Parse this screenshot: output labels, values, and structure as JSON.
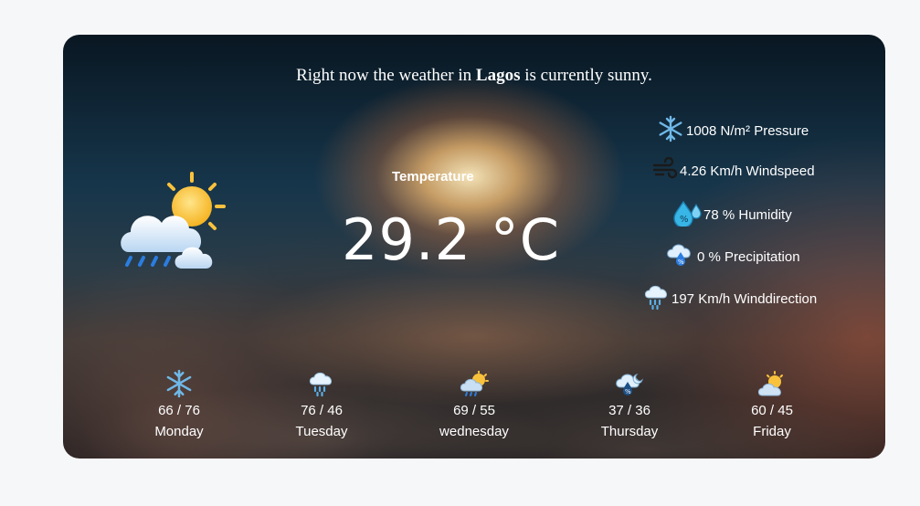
{
  "headline": {
    "prefix": "Right now the weather in ",
    "city": "Lagos",
    "suffix": " is currently sunny."
  },
  "current": {
    "icon": "sun-behind-rain-cloud-icon",
    "temperature_label": "Temperature",
    "temperature_value": "29.2 °C"
  },
  "stats": [
    {
      "icon": "snowflake-icon",
      "text": "1008 N/m² Pressure"
    },
    {
      "icon": "wind-icon",
      "text": "4.26 Km/h Windspeed"
    },
    {
      "icon": "humidity-drops-icon",
      "text": "78 % Humidity"
    },
    {
      "icon": "precipitation-cloud-icon",
      "text": "0 % Precipitation"
    },
    {
      "icon": "rain-cloud-icon",
      "text": "197 Km/h Winddirection"
    }
  ],
  "forecast": [
    {
      "icon": "snowflake-icon",
      "range": "66 / 76",
      "day": "Monday"
    },
    {
      "icon": "rain-cloud-icon",
      "range": "76 / 46",
      "day": "Tuesday"
    },
    {
      "icon": "sun-rain-cloud-icon",
      "range": "69 / 55",
      "day": "wednesday"
    },
    {
      "icon": "cloud-moon-drops-icon",
      "range": "37 / 36",
      "day": "Thursday"
    },
    {
      "icon": "sun-behind-cloud-icon",
      "range": "60 / 45",
      "day": "Friday"
    }
  ],
  "colors": {
    "page_background": "#f6f7f9",
    "text": "#ffffff",
    "sun": "#f9c23c",
    "cloud": "#dfeffc",
    "rain": "#2b7de0",
    "snow": "#6fb8e8"
  }
}
